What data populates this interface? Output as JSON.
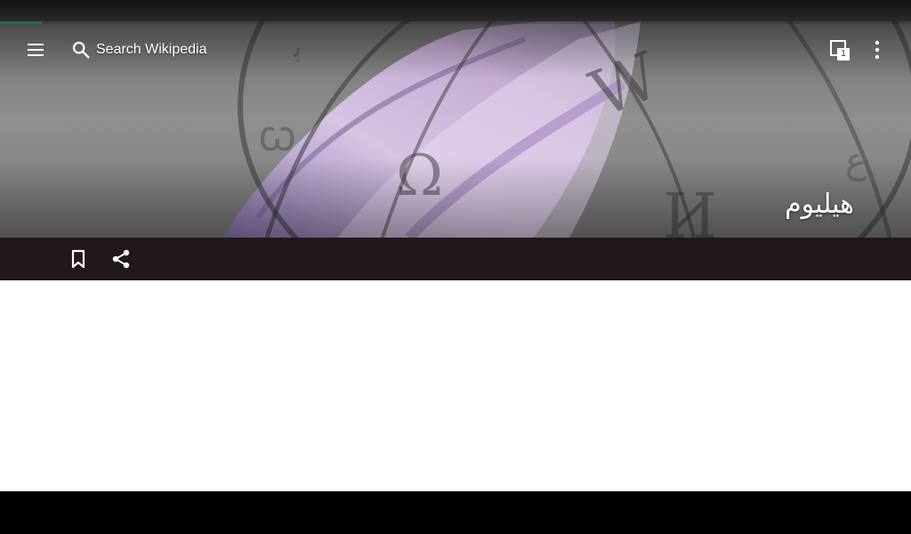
{
  "toolbar": {
    "menu_icon": "hamburger-menu-icon",
    "search_icon": "magnifier-search-icon",
    "search_placeholder": "Search Wikipedia",
    "tabs_icon": "tabs-stack-icon",
    "tab_count": "1",
    "overflow_icon": "vertical-dots-icon"
  },
  "article": {
    "title": "هيليوم"
  },
  "actions": {
    "save_icon": "bookmark-outline-icon",
    "share_icon": "share-icon"
  },
  "progress": {
    "value": 0.046
  },
  "colors": {
    "accent": "#2aa391",
    "action_bar": "#211819",
    "content_background": "#ffffff",
    "status_bar": "#1a1a1a"
  }
}
